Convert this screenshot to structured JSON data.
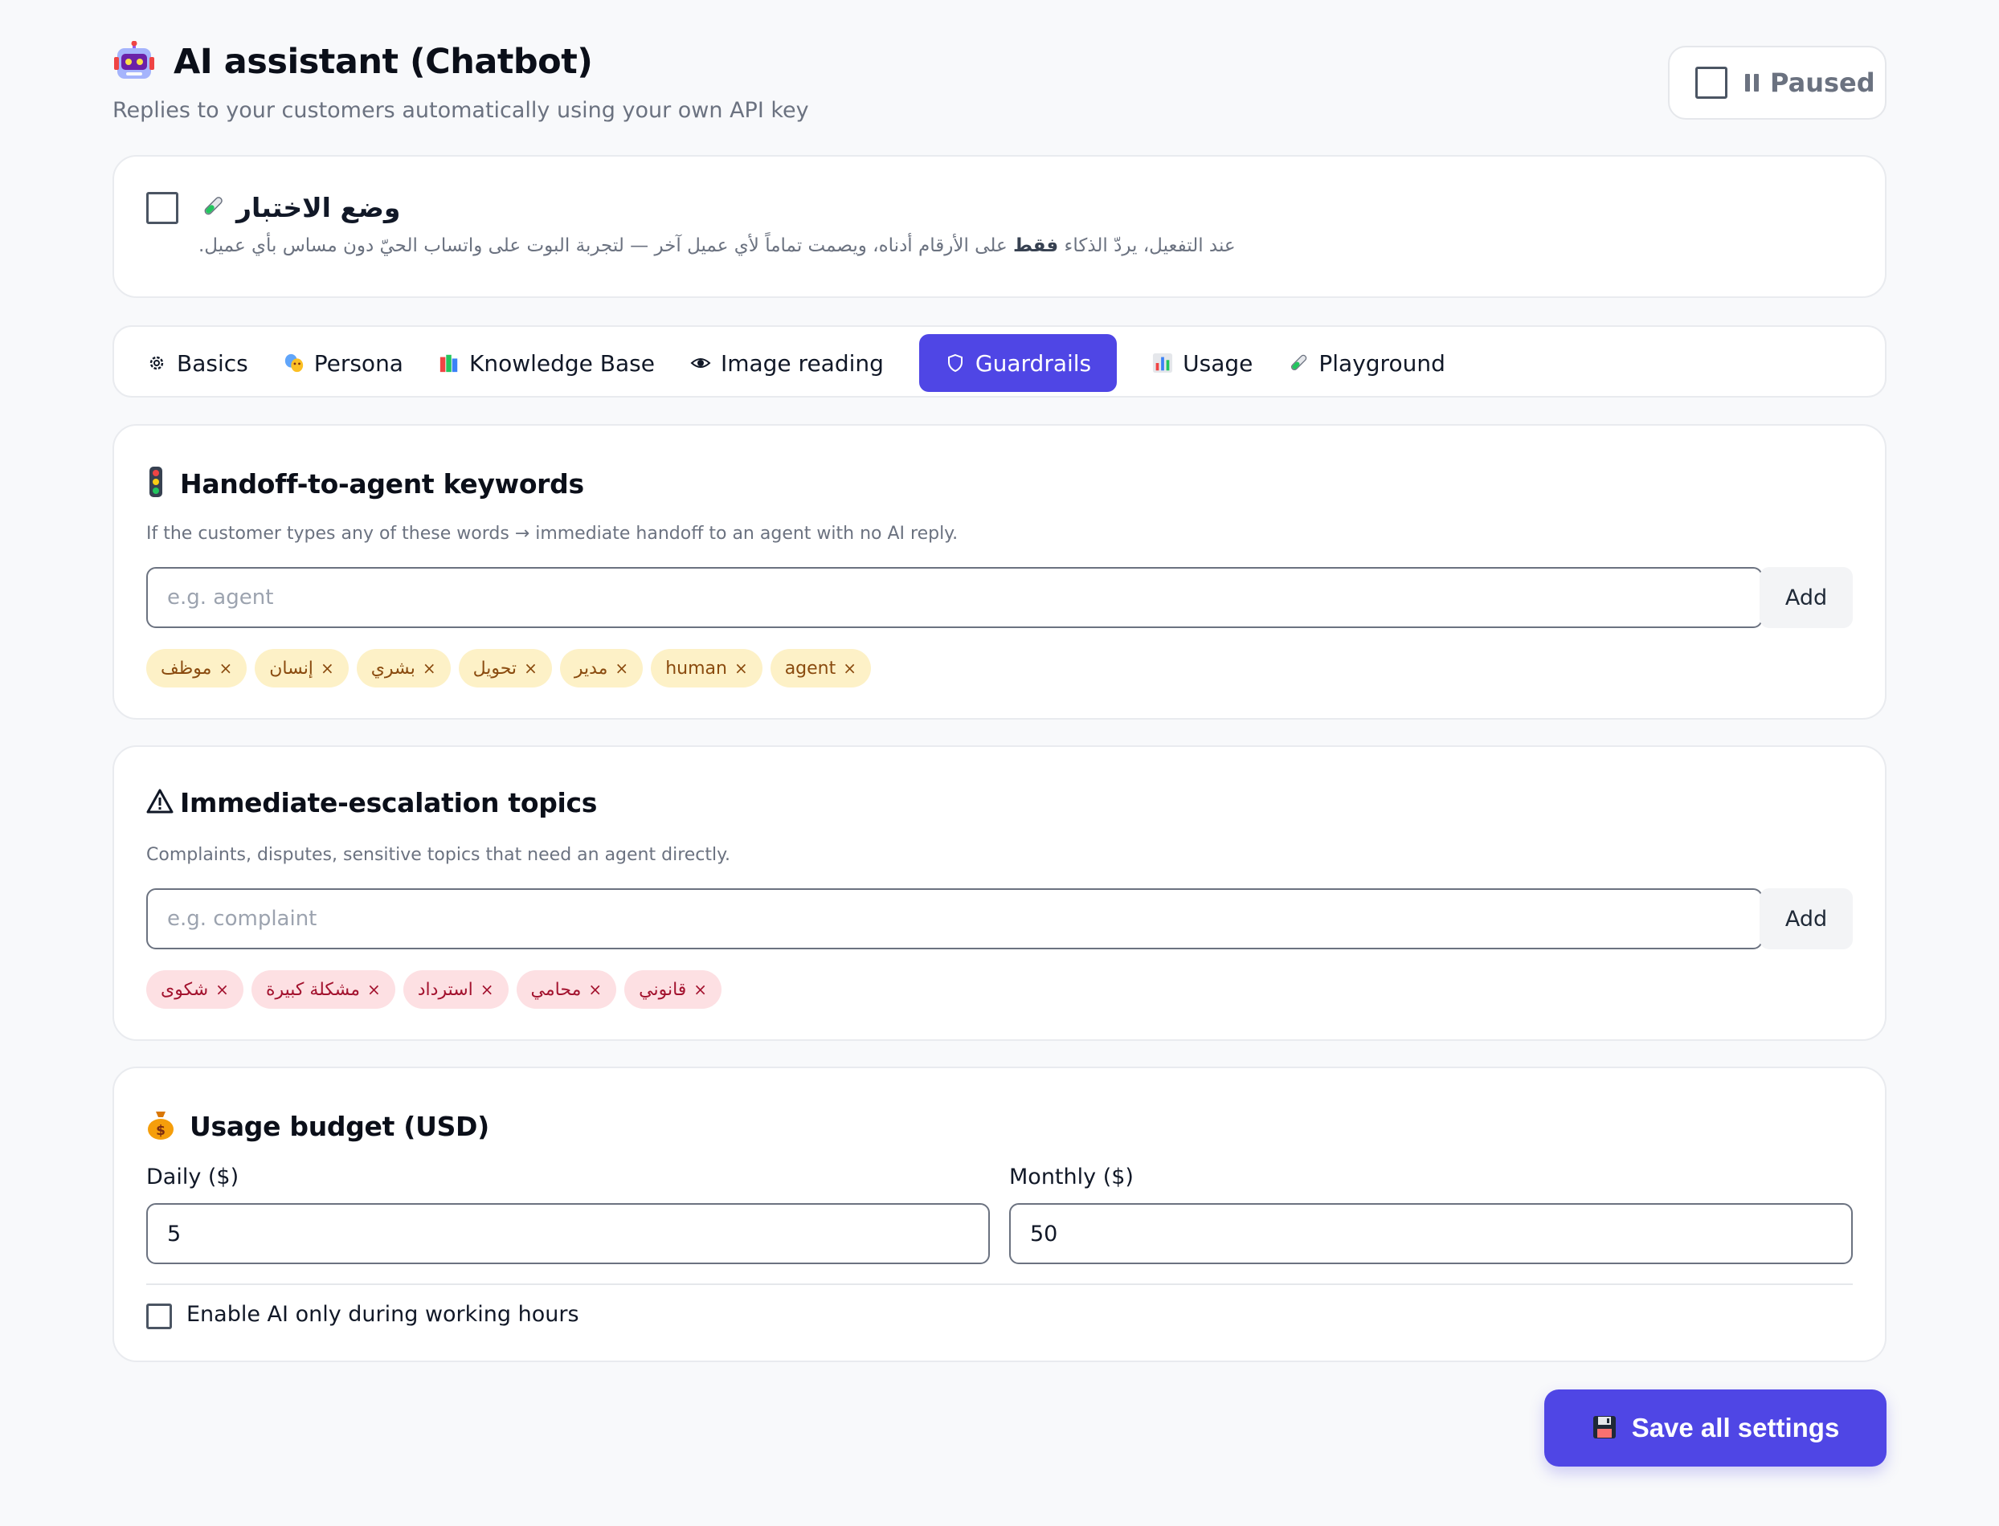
{
  "header": {
    "title": "AI assistant (Chatbot)",
    "subtitle": "Replies to your customers automatically using your own API key",
    "icon": "robot-icon",
    "status_toggle": {
      "label": "Paused",
      "icon": "pause-icon",
      "checked": false
    }
  },
  "test_mode": {
    "title": "وضع الاختبار",
    "icon": "test-tube-icon",
    "checked": false,
    "desc_before": "عند التفعيل، يردّ الذكاء ",
    "desc_bold": "فقط",
    "desc_after": " على الأرقام أدناه، ويصمت تماماً لأي عميل آخر — لتجربة البوت على واتساب الحيّ دون مساس بأي عميل."
  },
  "tabs": [
    {
      "label": "Basics",
      "icon": "gear-icon",
      "active": false
    },
    {
      "label": "Persona",
      "icon": "theater-masks-icon",
      "active": false
    },
    {
      "label": "Knowledge Base",
      "icon": "books-icon",
      "active": false
    },
    {
      "label": "Image reading",
      "icon": "eye-icon",
      "active": false
    },
    {
      "label": "Guardrails",
      "icon": "shield-icon",
      "active": true
    },
    {
      "label": "Usage",
      "icon": "bar-chart-icon",
      "active": false
    },
    {
      "label": "Playground",
      "icon": "test-tube-icon",
      "active": false
    }
  ],
  "handoff": {
    "title": "Handoff-to-agent keywords",
    "icon": "traffic-light-icon",
    "description": "If the customer types any of these words → immediate handoff to an agent with no AI reply.",
    "input_placeholder": "e.g. agent",
    "add_label": "Add",
    "keywords": [
      "موظف",
      "إنسان",
      "بشري",
      "تحويل",
      "مدير",
      "human",
      "agent"
    ]
  },
  "escalation": {
    "title": "Immediate-escalation topics",
    "icon": "warning-icon",
    "description": "Complaints, disputes, sensitive topics that need an agent directly.",
    "input_placeholder": "e.g. complaint",
    "add_label": "Add",
    "topics": [
      "شكوى",
      "مشكلة كبيرة",
      "استرداد",
      "محامي",
      "قانوني"
    ]
  },
  "budget": {
    "title": "Usage budget (USD)",
    "icon": "money-bag-icon",
    "daily_label": "Daily ($)",
    "daily_value": "5",
    "monthly_label": "Monthly ($)",
    "monthly_value": "50",
    "working_hours_label": "Enable AI only during working hours",
    "working_hours_checked": false
  },
  "save": {
    "label": "Save all settings",
    "icon": "floppy-disk-icon"
  },
  "colors": {
    "accent": "#4f46e5",
    "handoff_chip_bg": "#fdf1c7",
    "escalation_chip_bg": "#fde0e3"
  },
  "chip_remove_glyph": "×"
}
